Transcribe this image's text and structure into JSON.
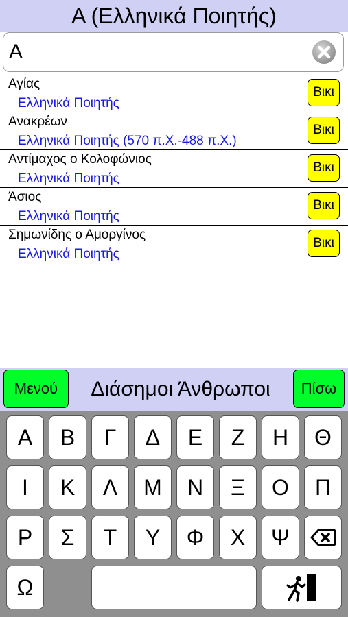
{
  "title": "Α (Ελληνικά Ποιητής)",
  "search": {
    "value": "Α"
  },
  "icons": {
    "clear": "clear-x-icon",
    "backspace": "backspace-icon",
    "exit": "exit-door-icon"
  },
  "results": [
    {
      "name": "Αγίας",
      "subtitle": "Ελληνικά Ποιητής",
      "wiki_label": "Βικι"
    },
    {
      "name": "Ανακρέων",
      "subtitle": "Ελληνικά Ποιητής (570 π.Χ.-488 π.Χ.)",
      "wiki_label": "Βικι"
    },
    {
      "name": "Αντίμαχος ο Κολοφώνιος",
      "subtitle": "Ελληνικά Ποιητής",
      "wiki_label": "Βικι"
    },
    {
      "name": "Άσιος",
      "subtitle": "Ελληνικά Ποιητής",
      "wiki_label": "Βικι"
    },
    {
      "name": "Σημωνίδης ο Αμοργίνος",
      "subtitle": "Ελληνικά Ποιητής",
      "wiki_label": "Βικι"
    }
  ],
  "nav": {
    "menu_label": "Μενού",
    "title": "Διάσημοι Άνθρωποι",
    "back_label": "Πίσω"
  },
  "keyboard": {
    "row1": [
      "Α",
      "Β",
      "Γ",
      "Δ",
      "Ε",
      "Ζ",
      "Η",
      "Θ"
    ],
    "row2": [
      "Ι",
      "Κ",
      "Λ",
      "Μ",
      "Ν",
      "Ξ",
      "Ο",
      "Π"
    ],
    "row3": [
      "Ρ",
      "Σ",
      "Τ",
      "Υ",
      "Φ",
      "Χ",
      "Ψ"
    ],
    "row4": [
      "Ω"
    ]
  },
  "colors": {
    "bar_bg": "#cfd0f3",
    "wiki_button": "#ffff00",
    "nav_button": "#00ff2a",
    "subtitle_text": "#1a1adb",
    "keyboard_bg": "#8f8f8f"
  }
}
